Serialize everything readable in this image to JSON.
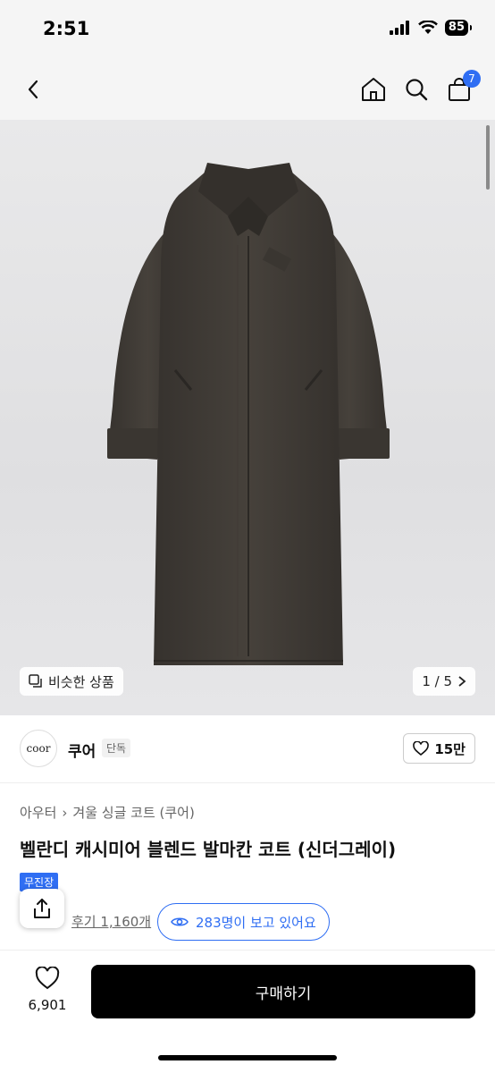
{
  "status": {
    "time": "2:51",
    "battery": "85"
  },
  "nav": {
    "back_icon": "chevron-left-icon",
    "home_icon": "home-icon",
    "search_icon": "search-icon",
    "cart_icon": "bag-icon",
    "cart_count": "7"
  },
  "gallery": {
    "similar_label": "비슷한 상품",
    "page_indicator": "1 / 5"
  },
  "brand": {
    "logo_text": "coor",
    "name": "쿠어",
    "tag": "단독",
    "likes": "15만"
  },
  "product": {
    "breadcrumb": [
      "아우터",
      "겨울 싱글 코트 (쿠어)"
    ],
    "title": "벨란디 캐시미어 블렌드 발마칸 코트 (신더그레이)",
    "promo_badge": "무진장",
    "reviews": "후기 1,160개",
    "viewers": "283명이 보고 있어요"
  },
  "bottom": {
    "wish_count": "6,901",
    "buy_label": "구매하기"
  },
  "colors": {
    "accent": "#2f6ef3",
    "buy_button": "#000000",
    "coat": "#3f3b36"
  }
}
